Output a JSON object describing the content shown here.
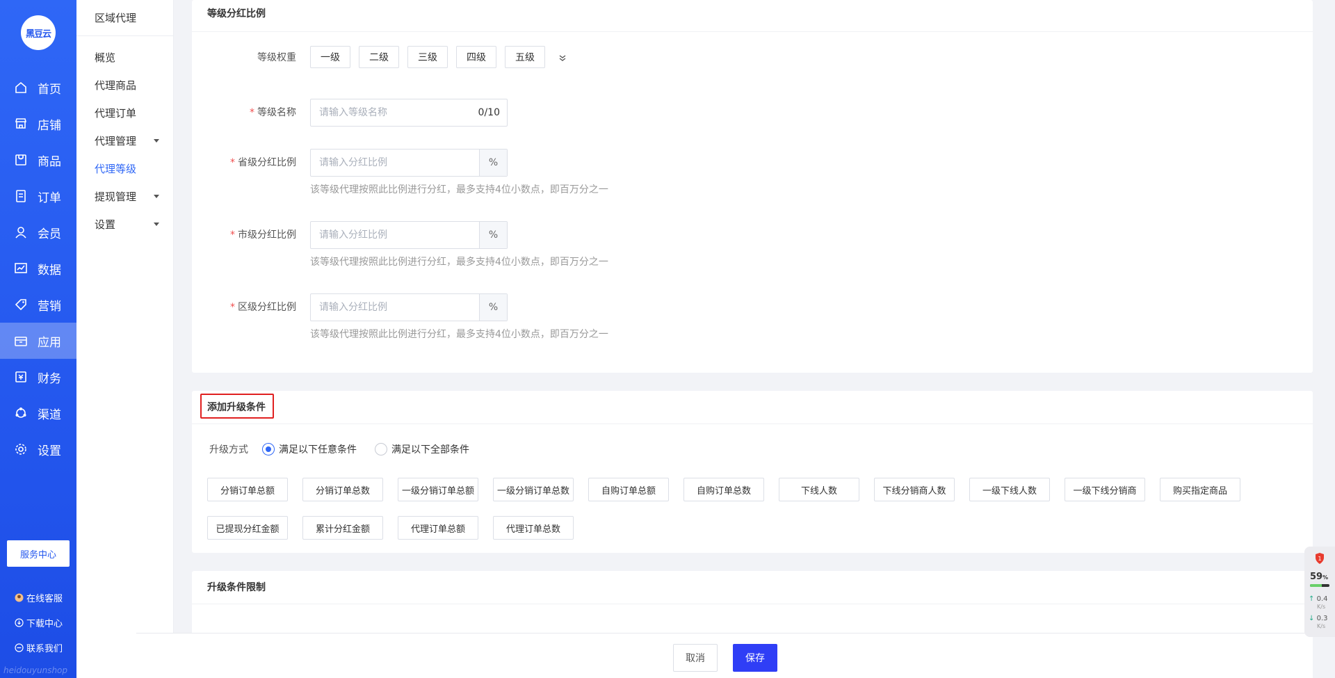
{
  "logo": {
    "text": "黑豆云"
  },
  "primary_nav": [
    {
      "label": "首页",
      "icon": "home-icon"
    },
    {
      "label": "店铺",
      "icon": "store-icon"
    },
    {
      "label": "商品",
      "icon": "goods-icon"
    },
    {
      "label": "订单",
      "icon": "order-icon"
    },
    {
      "label": "会员",
      "icon": "user-icon"
    },
    {
      "label": "数据",
      "icon": "chart-icon"
    },
    {
      "label": "营销",
      "icon": "tag-icon"
    },
    {
      "label": "应用",
      "icon": "app-icon",
      "active": true
    },
    {
      "label": "财务",
      "icon": "finance-icon"
    },
    {
      "label": "渠道",
      "icon": "channel-icon"
    },
    {
      "label": "设置",
      "icon": "gear-icon"
    }
  ],
  "service_center": "服务中心",
  "side_links": {
    "online_service": "在线客服",
    "download_center": "下载中心",
    "contact_us": "联系我们"
  },
  "watermark": "heidouyunshop",
  "secondary_nav": {
    "title": "区域代理",
    "items": [
      {
        "label": "概览",
        "caret": false
      },
      {
        "label": "代理商品",
        "caret": false
      },
      {
        "label": "代理订单",
        "caret": false
      },
      {
        "label": "代理管理",
        "caret": true
      },
      {
        "label": "代理等级",
        "caret": false,
        "active": true
      },
      {
        "label": "提现管理",
        "caret": true
      },
      {
        "label": "设置",
        "caret": true
      }
    ]
  },
  "level_section": {
    "title": "等级分红比例",
    "weight_label": "等级权重",
    "weights": [
      "一级",
      "二级",
      "三级",
      "四级",
      "五级"
    ],
    "name_label": "等级名称",
    "name_placeholder": "请输入等级名称",
    "name_count": "0/10",
    "province_label": "省级分红比例",
    "city_label": "市级分红比例",
    "district_label": "区级分红比例",
    "ratio_placeholder": "请输入分红比例",
    "percent": "%",
    "hint": "该等级代理按照此比例进行分红，最多支持4位小数点，即百万分之一"
  },
  "upgrade_section": {
    "title": "添加升级条件",
    "mode_label": "升级方式",
    "mode_any": "满足以下任意条件",
    "mode_all": "满足以下全部条件",
    "conditions_row1": [
      "分销订单总额",
      "分销订单总数",
      "一级分销订单总额",
      "一级分销订单总数",
      "自购订单总额",
      "自购订单总数",
      "下线人数",
      "下线分销商人数",
      "一级下线人数",
      "一级下线分销商",
      "购买指定商品"
    ],
    "conditions_row2": [
      "已提现分红金额",
      "累计分红金额",
      "代理订单总额",
      "代理订单总数"
    ]
  },
  "limit_section": {
    "title": "升级条件限制"
  },
  "footer": {
    "cancel": "取消",
    "save": "保存"
  },
  "monitor": {
    "badge": "1",
    "percent": "59",
    "percent_unit": "%",
    "cpu_fill": 0.59,
    "up": "0.4",
    "down": "0.3",
    "unit": "K/s"
  },
  "colors": {
    "primary": "#2f67f6",
    "save": "#2f3ef6",
    "required": "#f04f4f",
    "highlight": "#e02020"
  }
}
